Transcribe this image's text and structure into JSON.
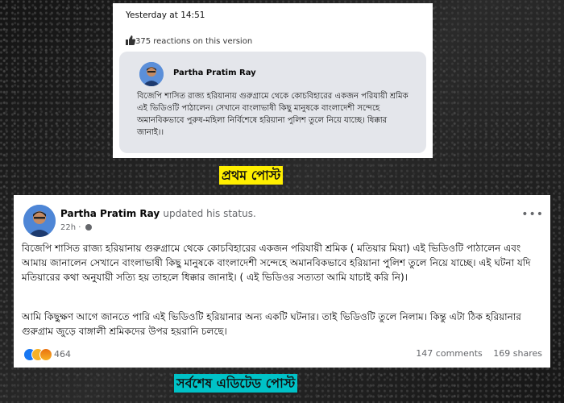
{
  "first_post": {
    "timestamp": "Yesterday at 14:51",
    "reactions_text": "375 reactions on this version",
    "author": "Partha Pratim Ray",
    "text": "বিজেপি শাসিত রাজ্য হরিয়ানায় গুরুগ্রামে থেকে কোচবিহারের একজন পরিযায়ী শ্রমিক এই ভিডিওটি পাঠালেন। সেখানে বাংলাভাষী কিছু মানুষকে বাংলাদেশী সন্দেহে অমানবিকভাবে পুরুষ-মহিলা নির্বিশেষে হরিয়ানা পুলিশ তুলে নিয়ে যাচ্ছে। ধিক্কার জানাই।।"
  },
  "label_first": "প্রথম পোস্ট",
  "label_latest": "সর্বশেষ এডিটেড পোস্ট",
  "latest_post": {
    "author": "Partha Pratim Ray",
    "action": "updated his status.",
    "time": "22h",
    "para1": "বিজেপি শাসিত রাজ্য হরিয়ানায় গুরুগ্রামে থেকে কোচবিহারের একজন পরিযায়ী শ্রমিক ( মতিয়ার মিয়া) এই ভিডিওটি পাঠালেন এবং আমায় জানালেন সেখানে বাংলাভাষী কিছু মানুষকে বাংলাদেশী সন্দেহে অমানবিকভাবে হরিয়ানা পুলিশ তুলে নিয়ে যাচ্ছে। এই ঘটনা যদি মতিয়ারের কথা অনুযায়ী সত্যি হয় তাহলে ধিক্কার জানাই। ( এই ভিডিওর সত্যতা আমি যাচাই করি নি)।",
    "para2": "আমি কিছুক্ষণ আগে জানতে পারি এই ভিডিওটি হরিয়ানার অন্য একটি ঘটনার। তাই ভিডিওটি তুলে নিলাম। কিন্তু এটা ঠিক হরিয়ানার গুরুগ্রাম জুড়ে বাঙ্গালী শ্রমিকদের উপর হয়রানি চলছে।",
    "reaction_count": "464",
    "comments": "147 comments",
    "shares": "169 shares"
  },
  "colors": {
    "label_first_bg": "#ffef00",
    "label_latest_bg": "#00c2c7",
    "like_blue": "#1877f2"
  }
}
